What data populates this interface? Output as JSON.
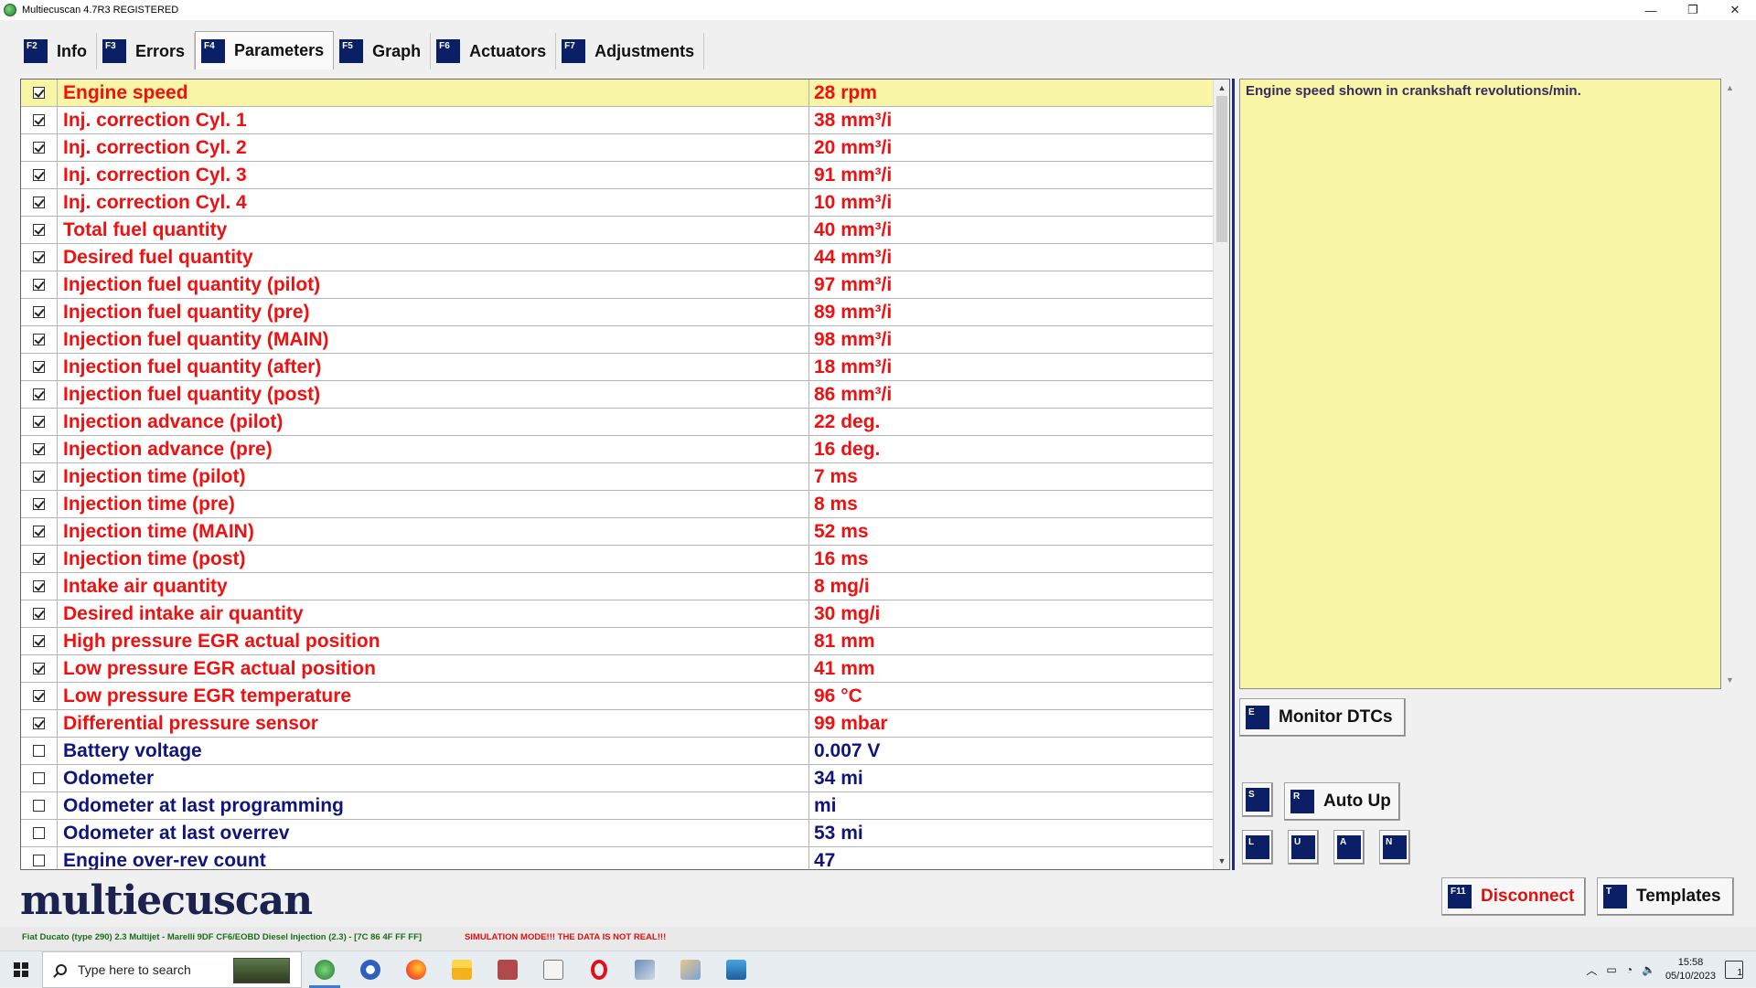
{
  "window": {
    "title": "Multiecuscan 4.7R3 REGISTERED",
    "controls": {
      "minimize": "—",
      "restore": "❐",
      "close": "✕"
    }
  },
  "tabs": [
    {
      "key": "F2",
      "label": "Info",
      "active": false
    },
    {
      "key": "F3",
      "label": "Errors",
      "active": false
    },
    {
      "key": "F4",
      "label": "Parameters",
      "active": true
    },
    {
      "key": "F5",
      "label": "Graph",
      "active": false
    },
    {
      "key": "F6",
      "label": "Actuators",
      "active": false
    },
    {
      "key": "F7",
      "label": "Adjustments",
      "active": false
    }
  ],
  "parameters": [
    {
      "name": "Engine speed",
      "value": "28 rpm",
      "checked": true,
      "selected": true
    },
    {
      "name": "Inj. correction Cyl. 1",
      "value": "38 mm³/i",
      "checked": true
    },
    {
      "name": "Inj. correction Cyl. 2",
      "value": "20 mm³/i",
      "checked": true
    },
    {
      "name": "Inj. correction Cyl. 3",
      "value": "91 mm³/i",
      "checked": true
    },
    {
      "name": "Inj. correction Cyl. 4",
      "value": "10 mm³/i",
      "checked": true
    },
    {
      "name": "Total fuel quantity",
      "value": "40 mm³/i",
      "checked": true
    },
    {
      "name": "Desired fuel quantity",
      "value": "44 mm³/i",
      "checked": true
    },
    {
      "name": "Injection fuel quantity (pilot)",
      "value": "97 mm³/i",
      "checked": true
    },
    {
      "name": "Injection fuel quantity (pre)",
      "value": "89 mm³/i",
      "checked": true
    },
    {
      "name": "Injection fuel quantity (MAIN)",
      "value": "98 mm³/i",
      "checked": true
    },
    {
      "name": "Injection fuel quantity (after)",
      "value": "18 mm³/i",
      "checked": true
    },
    {
      "name": "Injection fuel quantity (post)",
      "value": "86 mm³/i",
      "checked": true
    },
    {
      "name": "Injection advance (pilot)",
      "value": "22 deg.",
      "checked": true
    },
    {
      "name": "Injection advance (pre)",
      "value": "16 deg.",
      "checked": true
    },
    {
      "name": "Injection time (pilot)",
      "value": "7 ms",
      "checked": true
    },
    {
      "name": "Injection time (pre)",
      "value": "8 ms",
      "checked": true
    },
    {
      "name": "Injection time (MAIN)",
      "value": "52 ms",
      "checked": true
    },
    {
      "name": "Injection time (post)",
      "value": "16 ms",
      "checked": true
    },
    {
      "name": "Intake air quantity",
      "value": "8 mg/i",
      "checked": true
    },
    {
      "name": "Desired intake air quantity",
      "value": "30 mg/i",
      "checked": true
    },
    {
      "name": "High pressure EGR actual position",
      "value": "81 mm",
      "checked": true
    },
    {
      "name": "Low pressure EGR actual position",
      "value": "41 mm",
      "checked": true
    },
    {
      "name": "Low pressure EGR temperature",
      "value": "96 °C",
      "checked": true
    },
    {
      "name": "Differential pressure sensor",
      "value": "99 mbar",
      "checked": true
    },
    {
      "name": "Battery voltage",
      "value": "0.007 V",
      "checked": false
    },
    {
      "name": "Odometer",
      "value": "34 mi",
      "checked": false
    },
    {
      "name": "Odometer at last programming",
      "value": " mi",
      "checked": false
    },
    {
      "name": "Odometer at last overrev",
      "value": "53 mi",
      "checked": false
    },
    {
      "name": "Engine over-rev count",
      "value": "47",
      "checked": false
    }
  ],
  "description": "Engine speed shown in crankshaft revolutions/min.",
  "buttons": {
    "monitor_dtcs": {
      "key": "E",
      "label": "Monitor DTCs"
    },
    "s": {
      "key": "S"
    },
    "auto_up": {
      "key": "R",
      "label": "Auto Up"
    },
    "l": {
      "key": "L"
    },
    "u": {
      "key": "U"
    },
    "a": {
      "key": "A"
    },
    "n": {
      "key": "N"
    },
    "disconnect": {
      "key": "F11",
      "label": "Disconnect"
    },
    "templates": {
      "key": "T",
      "label": "Templates"
    }
  },
  "logo": "multiecuscan",
  "status": {
    "vehicle": "Fiat Ducato (type 290) 2.3 Multijet - Marelli 9DF CF6/EOBD Diesel Injection (2.3) - [7C 86 4F FF FF]",
    "simulation": "SIMULATION MODE!!! THE DATA IS NOT REAL!!!"
  },
  "taskbar": {
    "search_placeholder": "Type here to search",
    "time": "15:58",
    "date": "05/10/2023",
    "notification_count": "1"
  },
  "colors": {
    "checked_row_text": "#f01010",
    "unchecked_row_text": "#10157e",
    "selected_row_bg": "#f8f5a7",
    "key_badge": "#0a1f66"
  }
}
